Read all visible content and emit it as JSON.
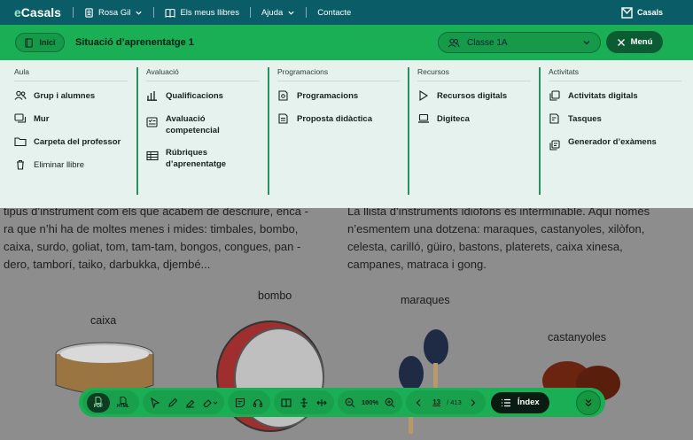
{
  "topbar": {
    "logo_e": "e",
    "logo_rest": "Casals",
    "user": "Rosa Gil",
    "my_books": "Els meus llibres",
    "help": "Ajuda",
    "contact": "Contacte",
    "brand": "Casals"
  },
  "greenbar": {
    "home_label": "Inici",
    "title": "Situació d’aprenentatge 1",
    "class_select_value": "Classe 1A",
    "menu_label": "Menú"
  },
  "menu": {
    "columns": [
      {
        "heading": "Aula",
        "items": [
          "Grup i alumnes",
          "Mur",
          "Carpeta del professor",
          "Eliminar llibre"
        ]
      },
      {
        "heading": "Avaluació",
        "items": [
          "Qualificacions",
          "Avaluació competencial",
          "Rúbriques d’aprenentatge"
        ]
      },
      {
        "heading": "Programacions",
        "items": [
          "Programacions",
          "Proposta didàctica"
        ]
      },
      {
        "heading": "Recursos",
        "items": [
          "Recursos digitals",
          "Digiteca"
        ]
      },
      {
        "heading": "Activitats",
        "items": [
          "Activitats digitals",
          "Tasques",
          "Generador d’exàmens"
        ]
      }
    ]
  },
  "content": {
    "left_text": [
      "tipus d’instrument com els que acabem de descriure, enca -",
      "ra que n’hi ha de moltes menes i mides: timbales, bombo,",
      "caixa, surdo, goliat, tom, tam-tam, bongos, congues, pan -",
      "dero, tamborí, taiko, darbukka, djembé..."
    ],
    "right_text": [
      "La llista d’instruments idiòfons és interminable. Aquí només",
      "n’esmentem una dotzena: maraques, castanyoles, xilòfon,",
      "celesta, carilló, güiro, bastons, platerets, caixa xinesa,",
      "campanes, matraca i gong."
    ],
    "labels": {
      "caixa": "caixa",
      "bombo": "bombo",
      "maraques": "maraques",
      "castanyoles": "castanyoles"
    }
  },
  "toolbar": {
    "pdf": "PDF",
    "html": "HTML",
    "zoom": "100%",
    "page_current": "13",
    "page_total": "/ 413",
    "index_label": "Índex"
  },
  "colors": {
    "topbar": "#0a5c66",
    "green": "#1aaf55",
    "dark_green": "#0c5c33",
    "menu_bg": "#e6f2ee"
  }
}
